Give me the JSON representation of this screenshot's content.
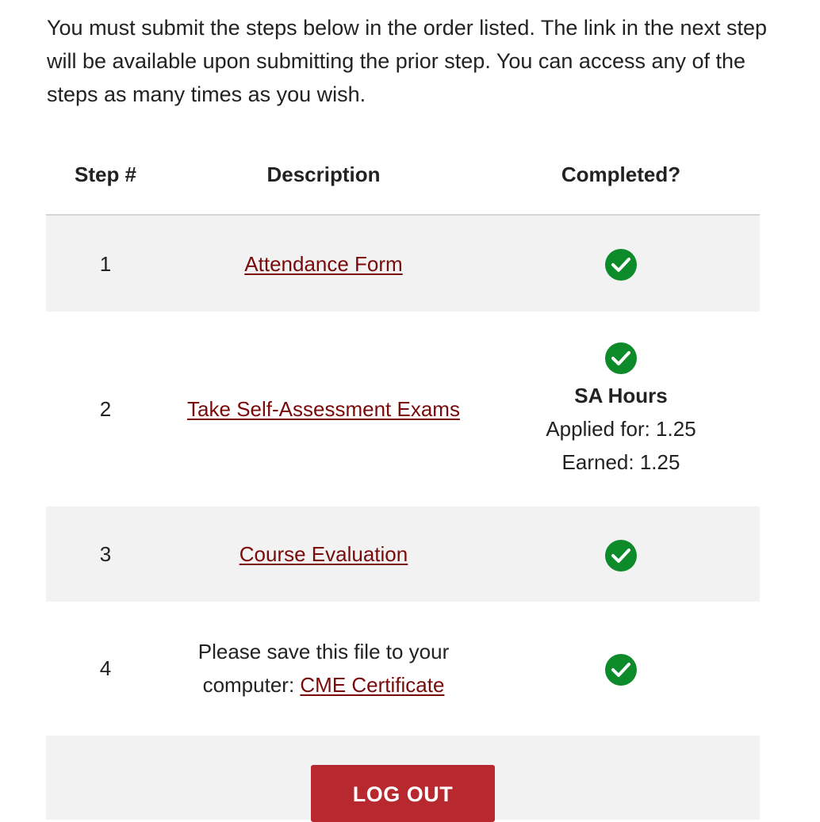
{
  "intro": {
    "text": "You must submit the steps below in the order listed. The link in the next step will be available upon submitting the prior step. You can access any of the steps as many times as you wish."
  },
  "table": {
    "headers": {
      "step": "Step #",
      "description": "Description",
      "completed": "Completed?"
    },
    "rows": [
      {
        "step": "1",
        "link": "Attendance Form",
        "completed": true
      },
      {
        "step": "2",
        "link": "Take Self-Assessment Exams",
        "completed": true,
        "sa_title": "SA Hours",
        "sa_applied": "Applied for: 1.25",
        "sa_earned": "Earned: 1.25"
      },
      {
        "step": "3",
        "link": "Course Evaluation",
        "completed": true
      },
      {
        "step": "4",
        "text_line1": "Please save this file to your",
        "text_prefix": "computer: ",
        "link": "CME Certificate",
        "completed": true
      }
    ]
  },
  "logout": {
    "label": "LOG OUT"
  },
  "colors": {
    "link": "#7a0a0a",
    "check": "#0d8a2a",
    "button": "#b8282f",
    "row_shade": "#f2f2f2"
  },
  "icons": {
    "completed": "check-circle-icon"
  }
}
